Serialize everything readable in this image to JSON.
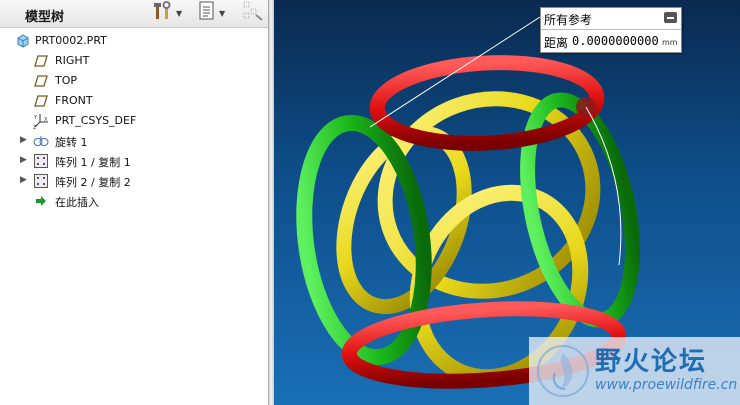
{
  "model_tree": {
    "title": "模型树",
    "items": [
      {
        "label": "PRT0002.PRT",
        "icon": "part-icon",
        "expandable": false
      },
      {
        "label": "RIGHT",
        "icon": "datum-plane-icon",
        "expandable": false
      },
      {
        "label": "TOP",
        "icon": "datum-plane-icon",
        "expandable": false
      },
      {
        "label": "FRONT",
        "icon": "datum-plane-icon",
        "expandable": false
      },
      {
        "label": "PRT_CSYS_DEF",
        "icon": "coordinate-system-icon",
        "expandable": false
      },
      {
        "label": "旋转 1",
        "icon": "revolve-icon",
        "expandable": true
      },
      {
        "label": "阵列 1 / 复制 1",
        "icon": "pattern-icon",
        "expandable": true
      },
      {
        "label": "阵列 2 / 复制 2",
        "icon": "pattern-icon",
        "expandable": true
      },
      {
        "label": "在此插入",
        "icon": "insert-here-arrow-icon",
        "expandable": false
      }
    ]
  },
  "measure": {
    "title": "所有参考",
    "label": "距离",
    "value": "0.0000000000",
    "unit": "mm"
  },
  "watermark": {
    "title": "野火论坛",
    "url": "www.proewildfire.cn"
  },
  "colors": {
    "viewport_top": "#0a2a50",
    "viewport_bottom": "#1a6fb5",
    "ring_red": "#e01010",
    "ring_green": "#1bb81b",
    "ring_yellow": "#e8d81a"
  }
}
